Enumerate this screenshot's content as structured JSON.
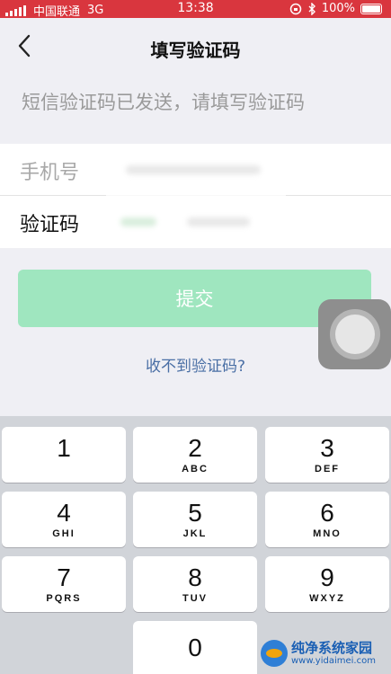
{
  "status_bar": {
    "carrier": "中国联通",
    "network": "3G",
    "time": "13:38",
    "battery_pct": "100%"
  },
  "nav": {
    "title": "填写验证码",
    "back_icon": "chevron-left-icon"
  },
  "hint": "短信验证码已发送，请填写验证码",
  "form": {
    "phone_label": "手机号",
    "code_label": "验证码"
  },
  "submit_label": "提交",
  "resend_label": "收不到验证码?",
  "keypad": [
    {
      "digit": "1",
      "letters": ""
    },
    {
      "digit": "2",
      "letters": "ABC"
    },
    {
      "digit": "3",
      "letters": "DEF"
    },
    {
      "digit": "4",
      "letters": "GHI"
    },
    {
      "digit": "5",
      "letters": "JKL"
    },
    {
      "digit": "6",
      "letters": "MNO"
    },
    {
      "digit": "7",
      "letters": "PQRS"
    },
    {
      "digit": "8",
      "letters": "TUV"
    },
    {
      "digit": "9",
      "letters": "WXYZ"
    },
    {
      "digit": "0",
      "letters": ""
    }
  ],
  "watermark": {
    "name": "纯净系统家园",
    "url": "www.yidaimei.com"
  },
  "colors": {
    "status_bar": "#d9363e",
    "submit": "#9fe6bf",
    "link": "#4a6fa5"
  }
}
